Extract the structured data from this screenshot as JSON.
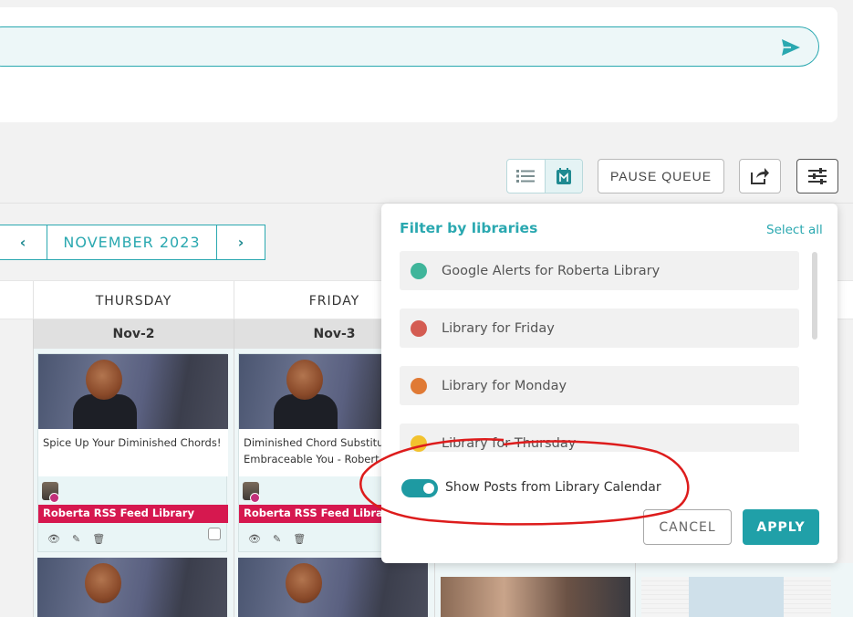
{
  "toolbar": {
    "pause_label": "PAUSE QUEUE"
  },
  "calendar": {
    "month_label": "NOVEMBER 2023",
    "prev_glyph": "‹",
    "next_glyph": "›",
    "days": [
      {
        "name": "THURSDAY",
        "date": "Nov-2"
      },
      {
        "name": "FRIDAY",
        "date": "Nov-3"
      }
    ],
    "posts": [
      {
        "text": "Spice Up Your Diminished Chords!",
        "library": "Roberta RSS Feed Library"
      },
      {
        "text": "Diminished Chord Substitu Embraceable You - Robert",
        "library": "Roberta RSS Feed Library"
      }
    ]
  },
  "filter_panel": {
    "title": "Filter by libraries",
    "select_all": "Select all",
    "libraries": [
      {
        "name": "Google Alerts for Roberta Library",
        "color": "#3fb59a"
      },
      {
        "name": "Library for Friday",
        "color": "#d45c52"
      },
      {
        "name": "Library for Monday",
        "color": "#e07a35"
      },
      {
        "name": "Library for Thursday",
        "color": "#f2c22e"
      }
    ],
    "toggle_label": "Show Posts from Library Calendar",
    "toggle_on": true,
    "cancel_label": "CANCEL",
    "apply_label": "APPLY"
  },
  "colors": {
    "accent": "#2aa8b0",
    "library_tag": "#d6184f"
  },
  "icons": [
    "send-icon",
    "list-view-icon",
    "calendar-view-icon",
    "share-icon",
    "filter-sliders-icon",
    "eye-icon",
    "edit-icon",
    "trash-icon"
  ]
}
